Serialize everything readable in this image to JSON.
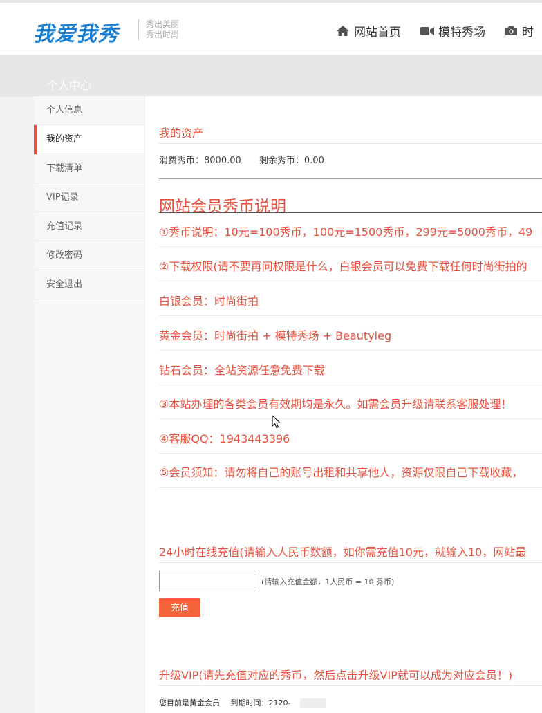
{
  "header": {
    "logo_text": "我爱我秀",
    "slogan_line1": "秀出美丽",
    "slogan_line2": "秀出时尚",
    "nav": [
      {
        "label": "网站首页",
        "icon": "home-icon"
      },
      {
        "label": "模特秀场",
        "icon": "video-camera-icon"
      },
      {
        "label": "时",
        "icon": "camera-icon"
      }
    ]
  },
  "banner": {
    "title": "个人中心"
  },
  "sidebar": {
    "items": [
      {
        "label": "个人信息",
        "active": false
      },
      {
        "label": "我的资产",
        "active": true
      },
      {
        "label": "下载清单",
        "active": false
      },
      {
        "label": "VIP记录",
        "active": false
      },
      {
        "label": "充值记录",
        "active": false
      },
      {
        "label": "修改密码",
        "active": false
      },
      {
        "label": "安全退出",
        "active": false
      }
    ]
  },
  "assets": {
    "title": "我的资产",
    "spent_label": "消费秀币：8000.00",
    "remaining_label": "剩余秀币：0.00"
  },
  "rules": {
    "title": "网站会员秀币说明",
    "items": [
      "①秀币说明：10元=100秀币，100元=1500秀币，299元=5000秀币，49",
      "②下载权限(请不要再问权限是什么，白银会员可以免费下载任何时尚街拍的",
      "白银会员：时尚街拍",
      "黄金会员：时尚街拍 + 模特秀场 + Beautyleg",
      "钻石会员：全站资源任意免费下载",
      "③本站办理的各类会员有效期均是永久。如需会员升级请联系客服处理！",
      "④客服QQ：1943443396",
      "⑤会员须知：请勿将自己的账号出租和共享他人，资源仅限自己下载收藏，"
    ]
  },
  "recharge": {
    "title": "24小时在线充值(请输入人民币数额，如你需充值10元，就输入10，网站最",
    "input_value": "",
    "hint": "(请输入充值金额，1人民币 = 10 秀币)",
    "button_label": "充值"
  },
  "vip": {
    "title": "升级VIP(请先充值对应的秀币，然后点击升级VIP就可以成为对应会员！)",
    "status": "您目前是黄金会员",
    "expiry_label": "到期时间：2120-"
  },
  "colors": {
    "accent": "#e8513e",
    "button": "#f4623a",
    "logo": "#1a7fd0"
  }
}
